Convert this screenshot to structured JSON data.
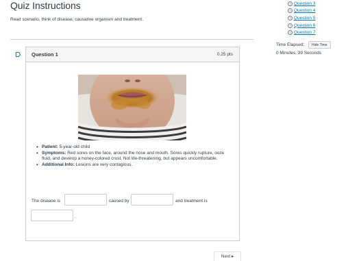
{
  "page": {
    "title": "Quiz Instructions",
    "instructions": "Read scenario, think of disease, causative organism and treatment."
  },
  "question_nav": [
    {
      "label": "Question 3"
    },
    {
      "label": "Question 4"
    },
    {
      "label": "Question 5"
    },
    {
      "label": "Question 6"
    },
    {
      "label": "Question 7"
    }
  ],
  "timer": {
    "label": "Time Elapsed:",
    "hide_label": "Hide Time",
    "value": "0 Minutes, 39 Seconds"
  },
  "question": {
    "title": "Question 1",
    "points": "0.25 pts",
    "details": [
      {
        "key": "Patient:",
        "text": " 5-year-old child"
      },
      {
        "key": "Symptoms:",
        "text": " Red sores on the face, around the nose and mouth. Sores quickly rupture, ooze fluid, and develop a honey-colored crust. Not life-threatening, but appears uncomfortable."
      },
      {
        "key": "Additional Info:",
        "text": " Lesions are very contagious."
      }
    ],
    "sentence": {
      "part1": "The disease is",
      "part2": "caused by",
      "part3": "and treatment is",
      "part4": "."
    },
    "blanks": [
      {
        "value": ""
      },
      {
        "value": ""
      },
      {
        "value": ""
      }
    ]
  },
  "footer": {
    "next_label": "Next ▸"
  },
  "colors": {
    "link": "#0374b5",
    "text": "#2d3b45",
    "border": "#c7cdd1"
  }
}
